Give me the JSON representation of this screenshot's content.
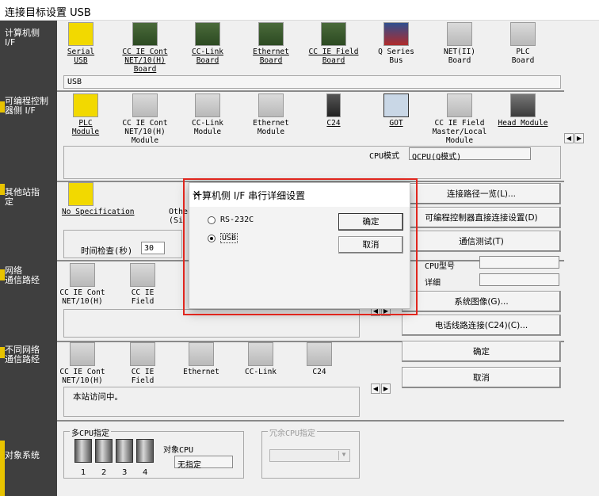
{
  "window": {
    "title": "连接目标设置 USB"
  },
  "sections": {
    "pc_if": "计算机侧\nI/F",
    "plc_if": "可编程控制\n器侧 I/F",
    "other_station": "其他站指\n定",
    "network_route": "网络\n通信路经",
    "diff_network": "不同网络\n通信路经",
    "target_system": "对象系统"
  },
  "pc_if_items": [
    {
      "label": "Serial\nUSB",
      "icon": "serial-usb-icon"
    },
    {
      "label": "CC IE Cont\nNET/10(H)\nBoard",
      "icon": "cc-ie-cont-board-icon"
    },
    {
      "label": "CC-Link\nBoard",
      "icon": "cc-link-board-icon"
    },
    {
      "label": "Ethernet\nBoard",
      "icon": "ethernet-board-icon"
    },
    {
      "label": "CC IE Field\nBoard",
      "icon": "cc-ie-field-board-icon"
    },
    {
      "label": "Q Series\nBus",
      "icon": "q-series-bus-icon"
    },
    {
      "label": "NET(II)\nBoard",
      "icon": "net-ii-board-icon"
    },
    {
      "label": "PLC\nBoard",
      "icon": "plc-board-icon"
    }
  ],
  "pc_if_value": "USB",
  "plc_if_items": [
    {
      "label": "PLC\nModule",
      "icon": "plc-module-icon"
    },
    {
      "label": "CC IE Cont\nNET/10(H)\nModule",
      "icon": "cc-ie-cont-module-icon"
    },
    {
      "label": "CC-Link\nModule",
      "icon": "cc-link-module-icon"
    },
    {
      "label": "Ethernet\nModule",
      "icon": "ethernet-module-icon"
    },
    {
      "label": "C24",
      "icon": "c24-icon"
    },
    {
      "label": "GOT",
      "icon": "got-icon"
    },
    {
      "label": "CC IE Field\nMaster/Local\nModule",
      "icon": "cc-ie-field-master-icon"
    },
    {
      "label": "Head Module",
      "icon": "head-module-icon"
    }
  ],
  "cpu_mode": {
    "label": "CPU模式",
    "value": "QCPU(Q模式)"
  },
  "other_station": {
    "no_spec": "No Specification",
    "other_partial": "Othe\n(Si",
    "time_check_label": "时间检查(秒)",
    "time_check_value": "30"
  },
  "network_items": [
    {
      "label": "CC IE Cont\nNET/10(H)",
      "icon": "net-cc-ie-cont-icon"
    },
    {
      "label": "CC IE\nField",
      "icon": "net-cc-ie-field-icon"
    }
  ],
  "diff_network_items": [
    {
      "label": "CC IE Cont\nNET/10(H)",
      "icon": "diff-cc-ie-cont-icon"
    },
    {
      "label": "CC IE\nField",
      "icon": "diff-cc-ie-field-icon"
    },
    {
      "label": "Ethernet",
      "icon": "diff-ethernet-icon"
    },
    {
      "label": "CC-Link",
      "icon": "diff-cc-link-icon"
    },
    {
      "label": "C24",
      "icon": "diff-c24-icon"
    }
  ],
  "status_text": "本站访问中。",
  "right_buttons": {
    "route_list": "连接路径一览(L)...",
    "direct_conn": "可编程控制器直接连接设置(D)",
    "comm_test": "通信测试(T)",
    "cpu_type_label": "CPU型号",
    "detail_label": "详细",
    "system_image": "系统图像(G)...",
    "phone_line": "电话线路连接(C24)(C)...",
    "ok": "确定",
    "cancel": "取消"
  },
  "multi_cpu": {
    "title": "多CPU指定",
    "numbers": [
      "1",
      "2",
      "3",
      "4"
    ],
    "target_cpu_label": "对象CPU",
    "target_cpu_value": "无指定"
  },
  "redundant_cpu": {
    "title": "冗余CPU指定"
  },
  "dialog": {
    "title": "计算机侧 I/F 串行详细设置",
    "options": [
      "RS-232C",
      "USB"
    ],
    "selected": "USB",
    "ok": "确定",
    "cancel": "取消"
  },
  "colors": {
    "highlight": "#e0261e",
    "panel_dark": "#3f3f3f"
  }
}
